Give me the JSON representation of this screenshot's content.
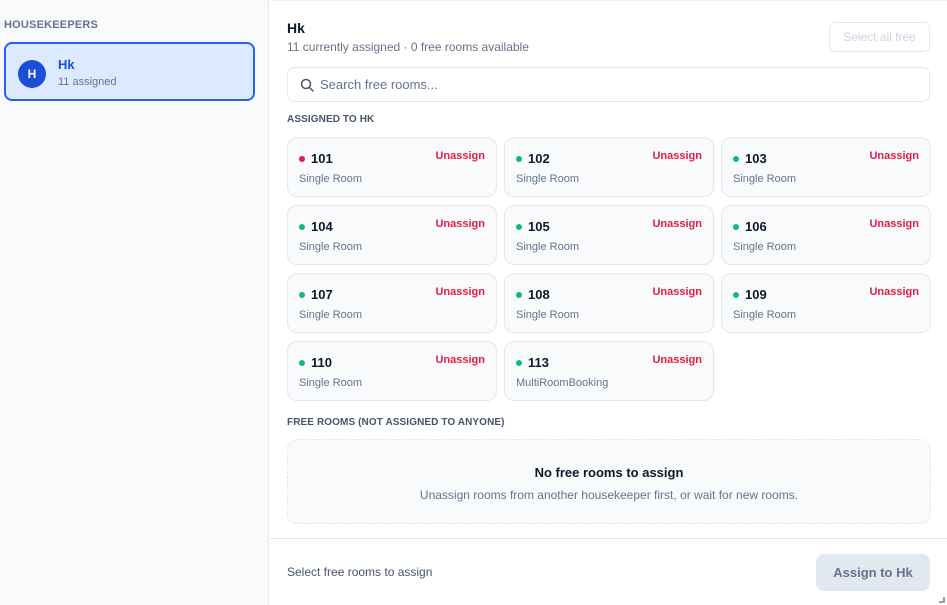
{
  "sidebar": {
    "heading": "HOUSEKEEPERS",
    "housekeepers": [
      {
        "initial": "H",
        "name": "Hk",
        "assigned": "11 assigned"
      }
    ]
  },
  "header": {
    "title": "Hk",
    "subtitle": "11 currently assigned · 0 free rooms available",
    "select_all_label": "Select all free"
  },
  "search": {
    "placeholder": "Search free rooms..."
  },
  "assigned_section": {
    "heading": "ASSIGNED TO HK",
    "unassign_label": "Unassign",
    "rooms": [
      {
        "number": "101",
        "type": "Single Room",
        "status": "red"
      },
      {
        "number": "102",
        "type": "Single Room",
        "status": "green"
      },
      {
        "number": "103",
        "type": "Single Room",
        "status": "green"
      },
      {
        "number": "104",
        "type": "Single Room",
        "status": "green"
      },
      {
        "number": "105",
        "type": "Single Room",
        "status": "green"
      },
      {
        "number": "106",
        "type": "Single Room",
        "status": "green"
      },
      {
        "number": "107",
        "type": "Single Room",
        "status": "green"
      },
      {
        "number": "108",
        "type": "Single Room",
        "status": "green"
      },
      {
        "number": "109",
        "type": "Single Room",
        "status": "green"
      },
      {
        "number": "110",
        "type": "Single Room",
        "status": "green"
      },
      {
        "number": "113",
        "type": "MultiRoomBooking",
        "status": "green"
      }
    ]
  },
  "free_section": {
    "heading": "FREE ROOMS (NOT ASSIGNED TO ANYONE)",
    "empty_title": "No free rooms to assign",
    "empty_subtitle": "Unassign rooms from another housekeeper first, or wait for new rooms."
  },
  "footer": {
    "hint": "Select free rooms to assign",
    "assign_label": "Assign to Hk"
  },
  "colors": {
    "accent": "#2563eb",
    "status_red": "#e11d48",
    "status_green": "#10b981",
    "unassign": "#e11d48"
  }
}
